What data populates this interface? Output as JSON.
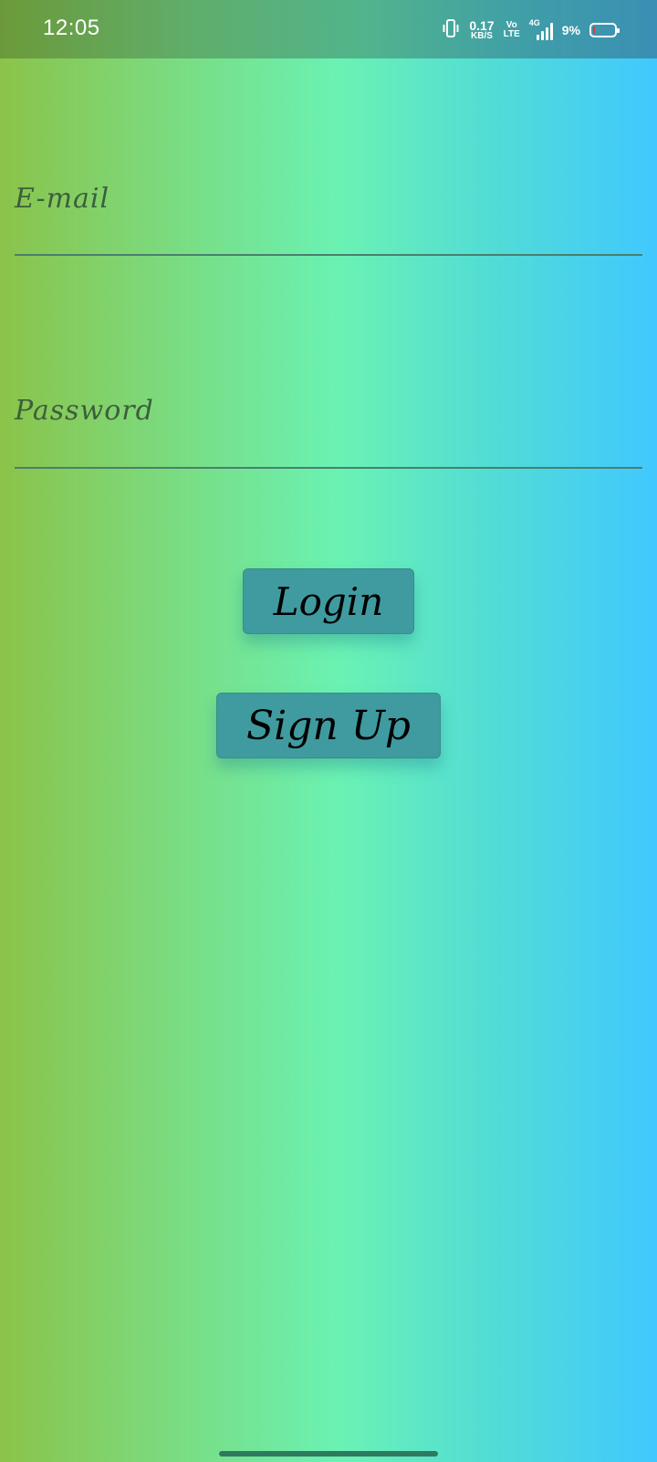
{
  "status_bar": {
    "time": "12:05",
    "net_speed_value": "0.17",
    "net_speed_unit": "KB/S",
    "volte_top": "Vo",
    "volte_bottom": "LTE",
    "network_type": "4G",
    "battery_percent": "9%",
    "battery_level": 0.09,
    "icons": [
      "vibrate-icon",
      "signal-icon",
      "battery-icon"
    ]
  },
  "form": {
    "email_label": "E-mail",
    "password_label": "Password"
  },
  "buttons": {
    "login_label": "Login",
    "signup_label": "Sign Up"
  },
  "colors": {
    "gradient_left": "#8bc34a",
    "gradient_mid": "#6af2b4",
    "gradient_right": "#40c8ff",
    "button_bg": "#3f9ba0",
    "label_color": "#3c5f3a",
    "battery_low": "#e53935"
  }
}
